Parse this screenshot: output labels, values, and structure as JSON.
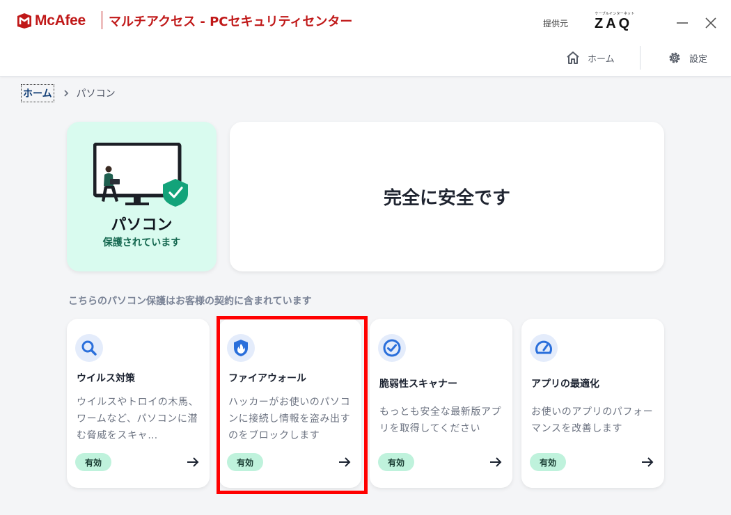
{
  "header": {
    "brand": "McAfee",
    "title": "マルチアクセス - PCセキュリティセンター",
    "provider_label": "提供元",
    "provider": {
      "small": "ケーブルインターネット",
      "big": "ZAQ"
    },
    "nav": {
      "home": "ホーム",
      "settings": "設定"
    }
  },
  "breadcrumb": {
    "home": "ホーム",
    "current": "パソコン"
  },
  "device": {
    "name": "パソコン",
    "status": "保護されています"
  },
  "summary": {
    "message": "完全に安全です"
  },
  "section_label": "こちらのパソコン保護はお客様の契約に含まれています",
  "features": [
    {
      "title": "ウイルス対策",
      "description": "ウイルスやトロイの木馬、ワームなど、パソコンに潜む脅威をスキャ…",
      "badge": "有効",
      "icon": "search-icon"
    },
    {
      "title": "ファイアウォール",
      "description": "ハッカーがお使いのパソコンに接続し情報を盗み出すのをブロックします",
      "badge": "有効",
      "icon": "firewall-shield-icon"
    },
    {
      "title": "脆弱性スキャナー",
      "description": "もっとも安全な最新版アプリを取得してください",
      "badge": "有効",
      "icon": "check-circle-icon"
    },
    {
      "title": "アプリの最適化",
      "description": "お使いのアプリのパフォーマンスを改善します",
      "badge": "有効",
      "icon": "speedometer-icon"
    }
  ],
  "colors": {
    "brand": "#c01818",
    "accent": "#2a6fdb",
    "protected_bg": "#d9fbef",
    "badge_bg": "#bff2dc",
    "highlight": "#ff0000"
  }
}
